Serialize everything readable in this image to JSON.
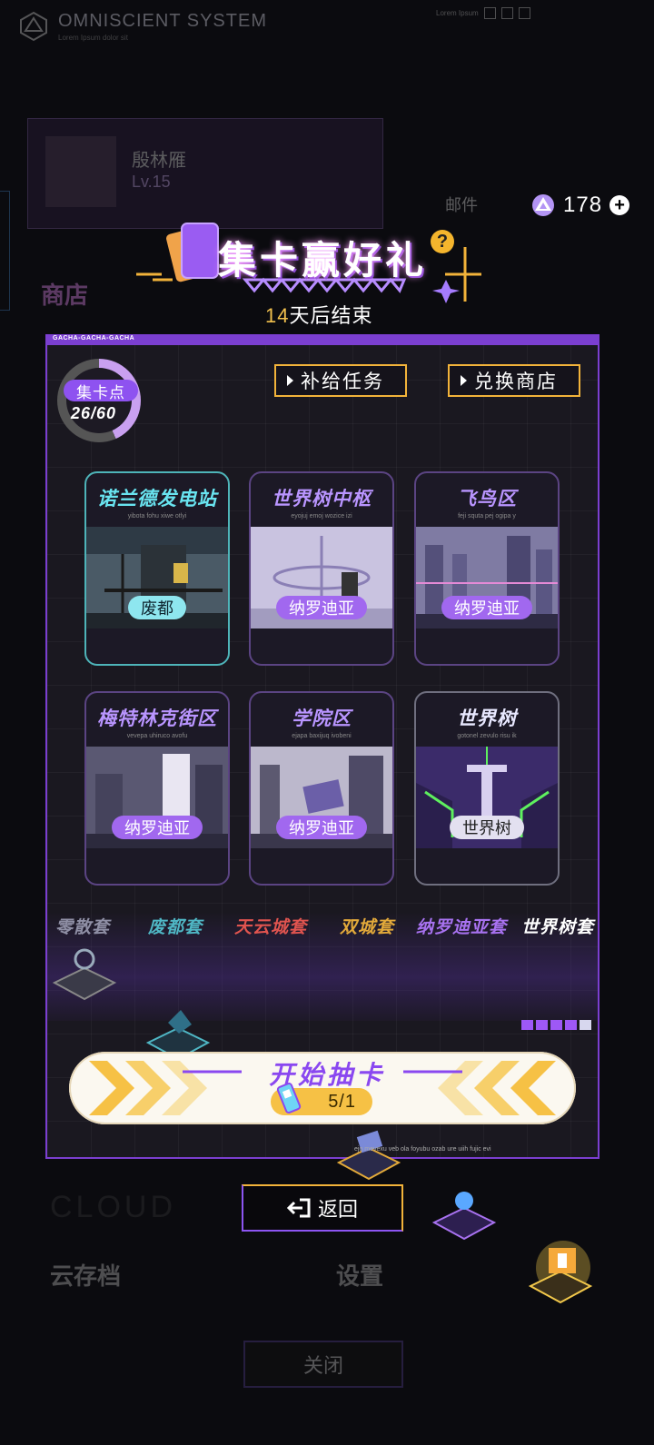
{
  "background": {
    "brand_title": "OMNISCIENT SYSTEM",
    "brand_sub": "Lorem Ipsum dolor sit",
    "hud_text": "Lorem Ipsum",
    "player_name": "殷林雁",
    "player_level": "Lv.15",
    "mail_label": "邮件",
    "shop_label": "商店",
    "cloud_label": "CLOUD",
    "cloud_save_label": "云存档",
    "settings_label": "设置",
    "close_label": "关闭"
  },
  "currency": {
    "amount": "178",
    "icon": "crystal-icon"
  },
  "header": {
    "title": "集卡赢好礼",
    "days": "14",
    "ends_text": "天后结束"
  },
  "panel": {
    "tag": "GACHA-GACHA-GACHA",
    "footer_text": "ejo mevexu veb ola foyubu ozab ure uiih fujic evi"
  },
  "points": {
    "label": "集卡点",
    "value": "26/60",
    "current": 26,
    "max": 60
  },
  "buttons": {
    "supply_tasks": "补给任务",
    "exchange_shop": "兑换商店",
    "back": "返回"
  },
  "cards": [
    {
      "title": "诺兰德发电站",
      "sub": "yibota fohu xiwe otlyi",
      "tag": "废都",
      "style": "teal"
    },
    {
      "title": "世界树中枢",
      "sub": "eyojuj emoj wozice izi",
      "tag": "纳罗迪亚",
      "style": "purple"
    },
    {
      "title": "飞鸟区",
      "sub": "feji squta pej ogipa y",
      "tag": "纳罗迪亚",
      "style": "purple"
    },
    {
      "title": "梅特林克街区",
      "sub": "vevepa uhiruco avofu",
      "tag": "纳罗迪亚",
      "style": "purple"
    },
    {
      "title": "学院区",
      "sub": "ejapa baxijuq ivobeni",
      "tag": "纳罗迪亚",
      "style": "purple"
    },
    {
      "title": "世界树",
      "sub": "gotonel zevulo risu ik",
      "tag": "世界树",
      "style": "green"
    }
  ],
  "sets": [
    {
      "label": "零散套",
      "color": "#8f8fa5"
    },
    {
      "label": "废都套",
      "color": "#4fb6c4"
    },
    {
      "label": "天云城套",
      "color": "#e0544f"
    },
    {
      "label": "双城套",
      "color": "#e2a93a"
    },
    {
      "label": "纳罗迪亚套",
      "color": "#a872f0"
    },
    {
      "label": "世界树套",
      "color": "#ffffff"
    }
  ],
  "draw": {
    "title": "开始抽卡",
    "cost": "5/1"
  }
}
